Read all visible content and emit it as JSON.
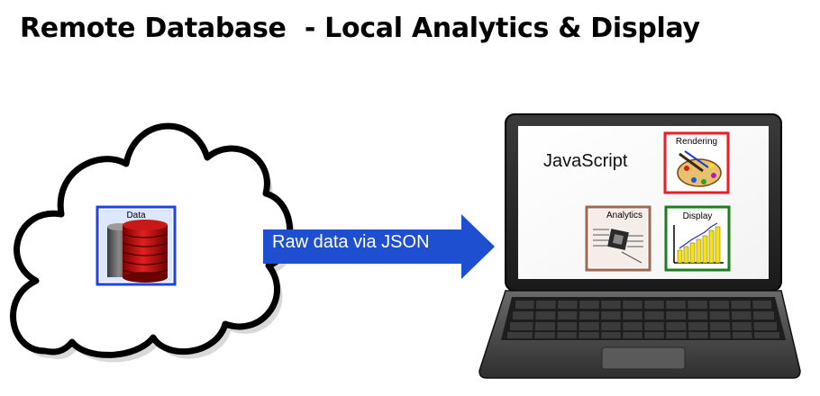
{
  "title": "Remote Database  - Local Analytics & Display",
  "cloud": {
    "db_label": "Data"
  },
  "arrow": {
    "label": "Raw data via JSON"
  },
  "laptop": {
    "screen_label": "JavaScript",
    "tiles": {
      "rendering": "Rendering",
      "analytics": "Analytics",
      "display": "Display"
    }
  },
  "colors": {
    "arrow": "#1f4fd1",
    "db_frame": "#2040e8",
    "rendering_frame": "#ee1c24",
    "analytics_frame": "#9c6a53",
    "display_frame": "#1e7d1e"
  },
  "icons": [
    "cloud-icon",
    "database-icon",
    "arrow-icon",
    "laptop-icon",
    "palette-icon",
    "chip-icon",
    "bar-chart-icon"
  ]
}
